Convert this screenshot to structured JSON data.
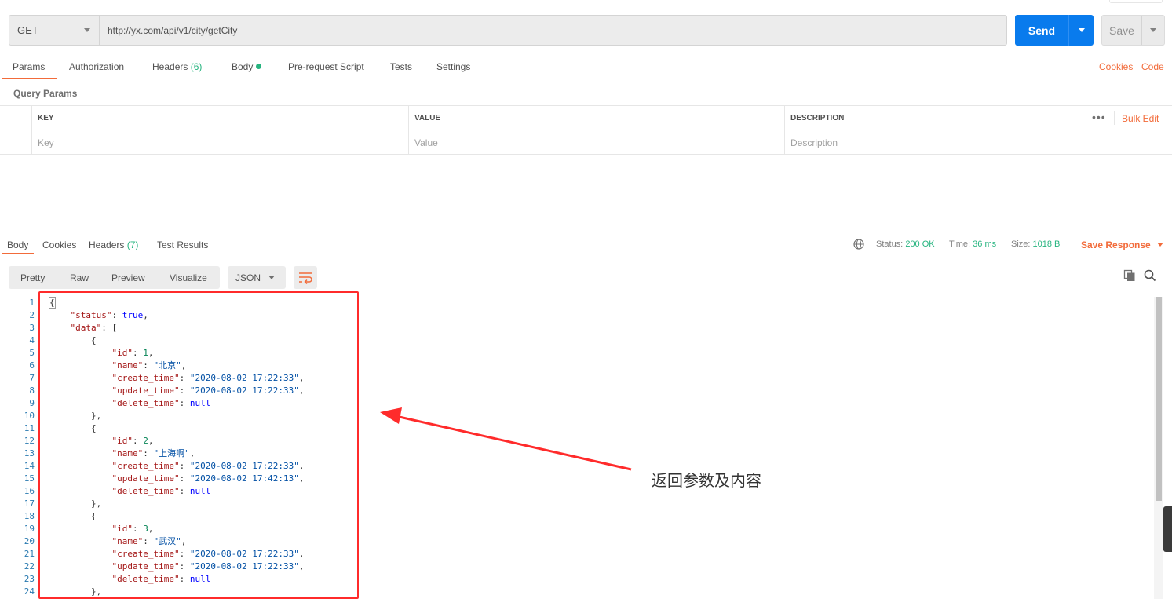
{
  "request": {
    "method": "GET",
    "url": "http://yx.com/api/v1/city/getCity",
    "send_label": "Send",
    "save_label": "Save"
  },
  "request_tabs": {
    "params": "Params",
    "authorization": "Authorization",
    "headers": "Headers",
    "headers_count": "(6)",
    "body": "Body",
    "prerequest": "Pre-request Script",
    "tests": "Tests",
    "settings": "Settings",
    "cookies": "Cookies",
    "code": "Code"
  },
  "query_params": {
    "title": "Query Params",
    "columns": {
      "key": "KEY",
      "value": "VALUE",
      "description": "DESCRIPTION"
    },
    "placeholders": {
      "key": "Key",
      "value": "Value",
      "description": "Description"
    },
    "more": "•••",
    "bulk_edit": "Bulk Edit"
  },
  "response_tabs": {
    "body": "Body",
    "cookies": "Cookies",
    "headers": "Headers",
    "headers_count": "(7)",
    "test_results": "Test Results"
  },
  "response_status": {
    "status_label": "Status:",
    "status_value": "200 OK",
    "time_label": "Time:",
    "time_value": "36 ms",
    "size_label": "Size:",
    "size_value": "1018 B",
    "save_response": "Save Response"
  },
  "view_modes": {
    "pretty": "Pretty",
    "raw": "Raw",
    "preview": "Preview",
    "visualize": "Visualize",
    "format": "JSON"
  },
  "code_lines": [
    [
      [
        "p",
        "{"
      ]
    ],
    [
      [
        "p",
        "    "
      ],
      [
        "k",
        "\"status\""
      ],
      [
        "p",
        ": "
      ],
      [
        "b",
        "true"
      ],
      [
        "p",
        ","
      ]
    ],
    [
      [
        "p",
        "    "
      ],
      [
        "k",
        "\"data\""
      ],
      [
        "p",
        ": ["
      ]
    ],
    [
      [
        "p",
        "        {"
      ]
    ],
    [
      [
        "p",
        "            "
      ],
      [
        "k",
        "\"id\""
      ],
      [
        "p",
        ": "
      ],
      [
        "n",
        "1"
      ],
      [
        "p",
        ","
      ]
    ],
    [
      [
        "p",
        "            "
      ],
      [
        "k",
        "\"name\""
      ],
      [
        "p",
        ": "
      ],
      [
        "s",
        "\"北京\""
      ],
      [
        "p",
        ","
      ]
    ],
    [
      [
        "p",
        "            "
      ],
      [
        "k",
        "\"create_time\""
      ],
      [
        "p",
        ": "
      ],
      [
        "s",
        "\"2020-08-02 17:22:33\""
      ],
      [
        "p",
        ","
      ]
    ],
    [
      [
        "p",
        "            "
      ],
      [
        "k",
        "\"update_time\""
      ],
      [
        "p",
        ": "
      ],
      [
        "s",
        "\"2020-08-02 17:22:33\""
      ],
      [
        "p",
        ","
      ]
    ],
    [
      [
        "p",
        "            "
      ],
      [
        "k",
        "\"delete_time\""
      ],
      [
        "p",
        ": "
      ],
      [
        "b",
        "null"
      ]
    ],
    [
      [
        "p",
        "        },"
      ]
    ],
    [
      [
        "p",
        "        {"
      ]
    ],
    [
      [
        "p",
        "            "
      ],
      [
        "k",
        "\"id\""
      ],
      [
        "p",
        ": "
      ],
      [
        "n",
        "2"
      ],
      [
        "p",
        ","
      ]
    ],
    [
      [
        "p",
        "            "
      ],
      [
        "k",
        "\"name\""
      ],
      [
        "p",
        ": "
      ],
      [
        "s",
        "\"上海啊\""
      ],
      [
        "p",
        ","
      ]
    ],
    [
      [
        "p",
        "            "
      ],
      [
        "k",
        "\"create_time\""
      ],
      [
        "p",
        ": "
      ],
      [
        "s",
        "\"2020-08-02 17:22:33\""
      ],
      [
        "p",
        ","
      ]
    ],
    [
      [
        "p",
        "            "
      ],
      [
        "k",
        "\"update_time\""
      ],
      [
        "p",
        ": "
      ],
      [
        "s",
        "\"2020-08-02 17:42:13\""
      ],
      [
        "p",
        ","
      ]
    ],
    [
      [
        "p",
        "            "
      ],
      [
        "k",
        "\"delete_time\""
      ],
      [
        "p",
        ": "
      ],
      [
        "b",
        "null"
      ]
    ],
    [
      [
        "p",
        "        },"
      ]
    ],
    [
      [
        "p",
        "        {"
      ]
    ],
    [
      [
        "p",
        "            "
      ],
      [
        "k",
        "\"id\""
      ],
      [
        "p",
        ": "
      ],
      [
        "n",
        "3"
      ],
      [
        "p",
        ","
      ]
    ],
    [
      [
        "p",
        "            "
      ],
      [
        "k",
        "\"name\""
      ],
      [
        "p",
        ": "
      ],
      [
        "s",
        "\"武汉\""
      ],
      [
        "p",
        ","
      ]
    ],
    [
      [
        "p",
        "            "
      ],
      [
        "k",
        "\"create_time\""
      ],
      [
        "p",
        ": "
      ],
      [
        "s",
        "\"2020-08-02 17:22:33\""
      ],
      [
        "p",
        ","
      ]
    ],
    [
      [
        "p",
        "            "
      ],
      [
        "k",
        "\"update_time\""
      ],
      [
        "p",
        ": "
      ],
      [
        "s",
        "\"2020-08-02 17:22:33\""
      ],
      [
        "p",
        ","
      ]
    ],
    [
      [
        "p",
        "            "
      ],
      [
        "k",
        "\"delete_time\""
      ],
      [
        "p",
        ": "
      ],
      [
        "b",
        "null"
      ]
    ],
    [
      [
        "p",
        "        },"
      ]
    ]
  ],
  "line_numbers": [
    "1",
    "2",
    "3",
    "4",
    "5",
    "6",
    "7",
    "8",
    "9",
    "10",
    "11",
    "12",
    "13",
    "14",
    "15",
    "16",
    "17",
    "18",
    "19",
    "20",
    "21",
    "22",
    "23",
    "24"
  ],
  "annotation": "返回参数及内容",
  "colors": {
    "accent": "#f26b3a",
    "send": "#097bed",
    "success": "#26b47f",
    "highlight": "#ff2b2b"
  }
}
